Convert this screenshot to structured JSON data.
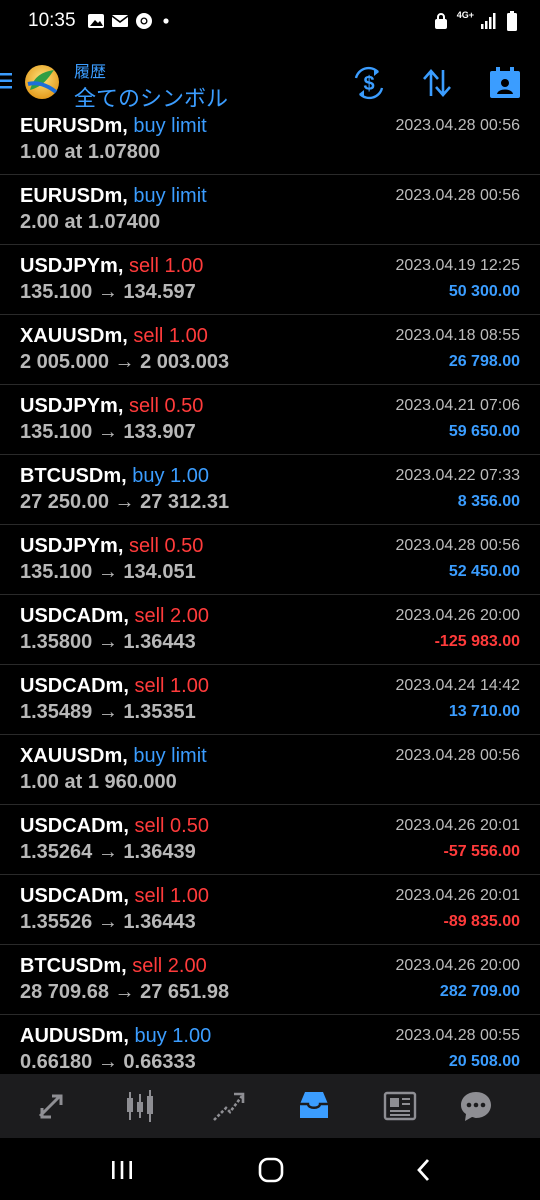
{
  "status": {
    "time": "10:35",
    "network": "4G+"
  },
  "header": {
    "subtitle": "履歴",
    "title": "全てのシンボル"
  },
  "toolbar": {
    "icons": [
      "exchange-icon",
      "sort-icon",
      "calendar-icon"
    ]
  },
  "orders": [
    {
      "symbol": "EURUSDm,",
      "side": "buy limit",
      "side_type": "buy",
      "prices": "1.00 at 1.07800",
      "date": "2023.04.28 00:56",
      "profit": "",
      "profit_type": "pos"
    },
    {
      "symbol": "EURUSDm,",
      "side": "buy limit",
      "side_type": "buy",
      "prices": "2.00 at 1.07400",
      "date": "2023.04.28 00:56",
      "profit": "",
      "profit_type": "pos"
    },
    {
      "symbol": "USDJPYm,",
      "side": "sell 1.00",
      "side_type": "sell",
      "prices": "135.100 → 134.597",
      "date": "2023.04.19 12:25",
      "profit": "50 300.00",
      "profit_type": "pos"
    },
    {
      "symbol": "XAUUSDm,",
      "side": "sell 1.00",
      "side_type": "sell",
      "prices": "2 005.000 → 2 003.003",
      "date": "2023.04.18 08:55",
      "profit": "26 798.00",
      "profit_type": "pos"
    },
    {
      "symbol": "USDJPYm,",
      "side": "sell 0.50",
      "side_type": "sell",
      "prices": "135.100 → 133.907",
      "date": "2023.04.21 07:06",
      "profit": "59 650.00",
      "profit_type": "pos"
    },
    {
      "symbol": "BTCUSDm,",
      "side": "buy 1.00",
      "side_type": "buy",
      "prices": "27 250.00 → 27 312.31",
      "date": "2023.04.22 07:33",
      "profit": "8 356.00",
      "profit_type": "pos"
    },
    {
      "symbol": "USDJPYm,",
      "side": "sell 0.50",
      "side_type": "sell",
      "prices": "135.100 → 134.051",
      "date": "2023.04.28 00:56",
      "profit": "52 450.00",
      "profit_type": "pos"
    },
    {
      "symbol": "USDCADm,",
      "side": "sell 2.00",
      "side_type": "sell",
      "prices": "1.35800 → 1.36443",
      "date": "2023.04.26 20:00",
      "profit": "-125 983.00",
      "profit_type": "neg"
    },
    {
      "symbol": "USDCADm,",
      "side": "sell 1.00",
      "side_type": "sell",
      "prices": "1.35489 → 1.35351",
      "date": "2023.04.24 14:42",
      "profit": "13 710.00",
      "profit_type": "pos"
    },
    {
      "symbol": "XAUUSDm,",
      "side": "buy limit",
      "side_type": "buy",
      "prices": "1.00 at 1 960.000",
      "date": "2023.04.28 00:56",
      "profit": "",
      "profit_type": "pos"
    },
    {
      "symbol": "USDCADm,",
      "side": "sell 0.50",
      "side_type": "sell",
      "prices": "1.35264 → 1.36439",
      "date": "2023.04.26 20:01",
      "profit": "-57 556.00",
      "profit_type": "neg"
    },
    {
      "symbol": "USDCADm,",
      "side": "sell 1.00",
      "side_type": "sell",
      "prices": "1.35526 → 1.36443",
      "date": "2023.04.26 20:01",
      "profit": "-89 835.00",
      "profit_type": "neg"
    },
    {
      "symbol": "BTCUSDm,",
      "side": "sell 2.00",
      "side_type": "sell",
      "prices": "28 709.68 → 27 651.98",
      "date": "2023.04.26 20:00",
      "profit": "282 709.00",
      "profit_type": "pos"
    },
    {
      "symbol": "AUDUSDm,",
      "side": "buy 1.00",
      "side_type": "buy",
      "prices": "0.66180 → 0.66333",
      "date": "2023.04.28 00:55",
      "profit": "20 508.00",
      "profit_type": "pos"
    }
  ],
  "bottom_nav": {
    "items": [
      "quotes-icon",
      "chart-icon",
      "trade-icon",
      "history-icon",
      "news-icon",
      "chat-icon"
    ],
    "active": 3
  },
  "colors": {
    "accent": "#3b9dff",
    "negative": "#ff3b3b",
    "nav_bg": "#1c1c1e"
  }
}
